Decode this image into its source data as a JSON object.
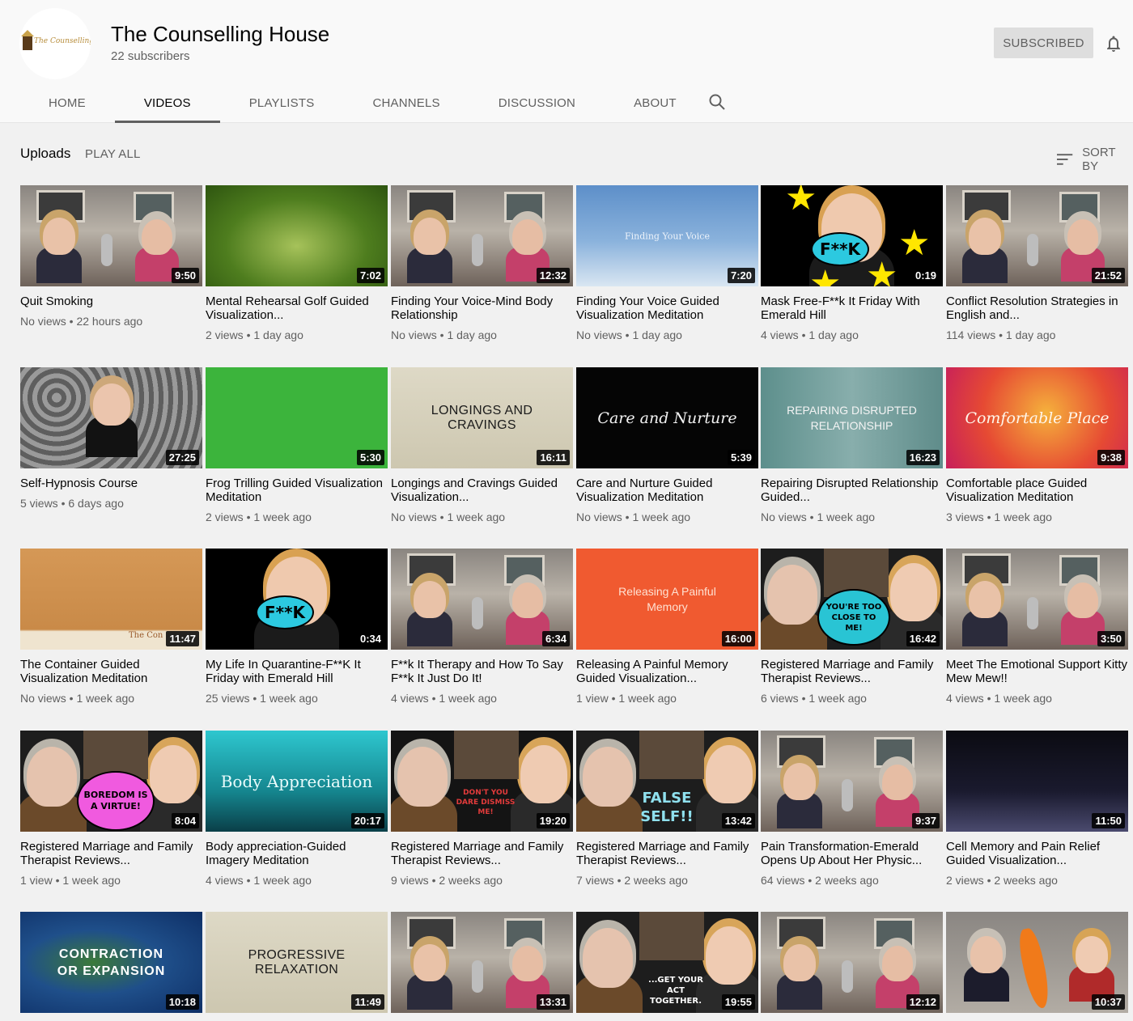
{
  "channel": {
    "name": "The Counselling House",
    "subscribers": "22 subscribers",
    "logo_text": "The Counselling House",
    "subscribe_label": "SUBSCRIBED"
  },
  "tabs": [
    "HOME",
    "VIDEOS",
    "PLAYLISTS",
    "CHANNELS",
    "DISCUSSION",
    "ABOUT"
  ],
  "active_tab": "VIDEOS",
  "section": {
    "title": "Uploads",
    "play_all": "PLAY ALL",
    "sort_by": "SORT BY"
  },
  "videos": [
    {
      "title": "Quit Smoking",
      "meta": "No views • 22 hours ago",
      "duration": "9:50",
      "thumb": "room"
    },
    {
      "title": "Mental Rehearsal Golf Guided Visualization...",
      "meta": "2 views • 1 day ago",
      "duration": "7:02",
      "thumb": "grass"
    },
    {
      "title": "Finding Your Voice-Mind Body Relationship",
      "meta": "No views • 1 day ago",
      "duration": "12:32",
      "thumb": "room"
    },
    {
      "title": "Finding Your Voice Guided Visualization Meditation",
      "meta": "No views • 1 day ago",
      "duration": "7:20",
      "thumb": "sky",
      "text": "Finding Your Voice"
    },
    {
      "title": "Mask Free-F**k It Friday With Emerald Hill",
      "meta": "4 views • 1 day ago",
      "duration": "0:19",
      "thumb": "fk_stars",
      "text": "F**K"
    },
    {
      "title": "Conflict Resolution Strategies in English and...",
      "meta": "114 views • 1 day ago",
      "duration": "21:52",
      "thumb": "room"
    },
    {
      "title": "Self-Hypnosis Course",
      "meta": "5 views • 6 days ago",
      "duration": "27:25",
      "thumb": "pattern"
    },
    {
      "title": "Frog Trilling Guided Visualization Meditation",
      "meta": "2 views • 1 week ago",
      "duration": "5:30",
      "thumb": "green"
    },
    {
      "title": "Longings and Cravings Guided Visualization...",
      "meta": "No views • 1 week ago",
      "duration": "16:11",
      "thumb": "beige",
      "text": "LONGINGS AND CRAVINGS"
    },
    {
      "title": "Care and Nurture Guided Visualization Meditation",
      "meta": "No views • 1 week ago",
      "duration": "5:39",
      "thumb": "black_script",
      "text": "Care and Nurture"
    },
    {
      "title": "Repairing Disrupted Relationship Guided...",
      "meta": "No views • 1 week ago",
      "duration": "16:23",
      "thumb": "teal",
      "text": "REPAIRING DISRUPTED RELATIONSHIP"
    },
    {
      "title": "Comfortable place Guided Visualization Meditation",
      "meta": "3 views • 1 week ago",
      "duration": "9:38",
      "thumb": "warm",
      "text": "Comfortable Place"
    },
    {
      "title": "The Container Guided Visualization Meditation",
      "meta": "No views • 1 week ago",
      "duration": "11:47",
      "thumb": "paper",
      "text": "The Con"
    },
    {
      "title": "My Life In Quarantine-F**K It Friday with Emerald Hill",
      "meta": "25 views • 1 week ago",
      "duration": "0:34",
      "thumb": "fk_black",
      "text": "F**K"
    },
    {
      "title": "F**k It Therapy and How To Say F**k It Just Do It!",
      "meta": "4 views • 1 week ago",
      "duration": "6:34",
      "thumb": "room"
    },
    {
      "title": "Releasing A Painful Memory Guided Visualization...",
      "meta": "1 view • 1 week ago",
      "duration": "16:00",
      "thumb": "orange",
      "text": "Releasing A Painful Memory"
    },
    {
      "title": "Registered Marriage and Family Therapist Reviews...",
      "meta": "6 views • 1 week ago",
      "duration": "16:42",
      "thumb": "reaction_teal",
      "text": "YOU'RE TOO CLOSE TO ME!"
    },
    {
      "title": "Meet The Emotional Support Kitty Mew Mew!!",
      "meta": "4 views • 1 week ago",
      "duration": "3:50",
      "thumb": "room"
    },
    {
      "title": "Registered Marriage and Family Therapist Reviews...",
      "meta": "1 view • 1 week ago",
      "duration": "8:04",
      "thumb": "reaction_pink",
      "text": "BOREDOM IS A VIRTUE!"
    },
    {
      "title": "Body appreciation-Guided Imagery Meditation",
      "meta": "4 views • 1 week ago",
      "duration": "20:17",
      "thumb": "aqua",
      "text": "Body Appreciation"
    },
    {
      "title": "Registered Marriage and Family Therapist Reviews...",
      "meta": "9 views • 2 weeks ago",
      "duration": "19:20",
      "thumb": "reaction_dark",
      "text": "DON'T YOU DARE DISMISS ME!"
    },
    {
      "title": "Registered Marriage and Family Therapist Reviews...",
      "meta": "7 views • 2 weeks ago",
      "duration": "13:42",
      "thumb": "reaction_false",
      "text": "FALSE SELF!!"
    },
    {
      "title": "Pain Transformation-Emerald Opens Up About Her Physic...",
      "meta": "64 views • 2 weeks ago",
      "duration": "9:37",
      "thumb": "room"
    },
    {
      "title": "Cell Memory and Pain Relief Guided Visualization...",
      "meta": "2 views • 2 weeks ago",
      "duration": "11:50",
      "thumb": "night"
    },
    {
      "title": "",
      "meta": "",
      "duration": "10:18",
      "thumb": "earth",
      "text": "CONTRACTION OR EXPANSION"
    },
    {
      "title": "",
      "meta": "",
      "duration": "11:49",
      "thumb": "beige",
      "text": "PROGRESSIVE RELAXATION"
    },
    {
      "title": "",
      "meta": "",
      "duration": "13:31",
      "thumb": "room"
    },
    {
      "title": "",
      "meta": "",
      "duration": "19:55",
      "thumb": "reaction_act",
      "text": "...GET YOUR ACT TOGETHER."
    },
    {
      "title": "",
      "meta": "",
      "duration": "12:12",
      "thumb": "room"
    },
    {
      "title": "",
      "meta": "",
      "duration": "10:37",
      "thumb": "carrot"
    }
  ],
  "colors": {
    "subscribed_bg": "#dedede",
    "meta_gray": "#606060",
    "page_bg": "#f1f1f1",
    "header_bg": "#f9f9f9"
  }
}
